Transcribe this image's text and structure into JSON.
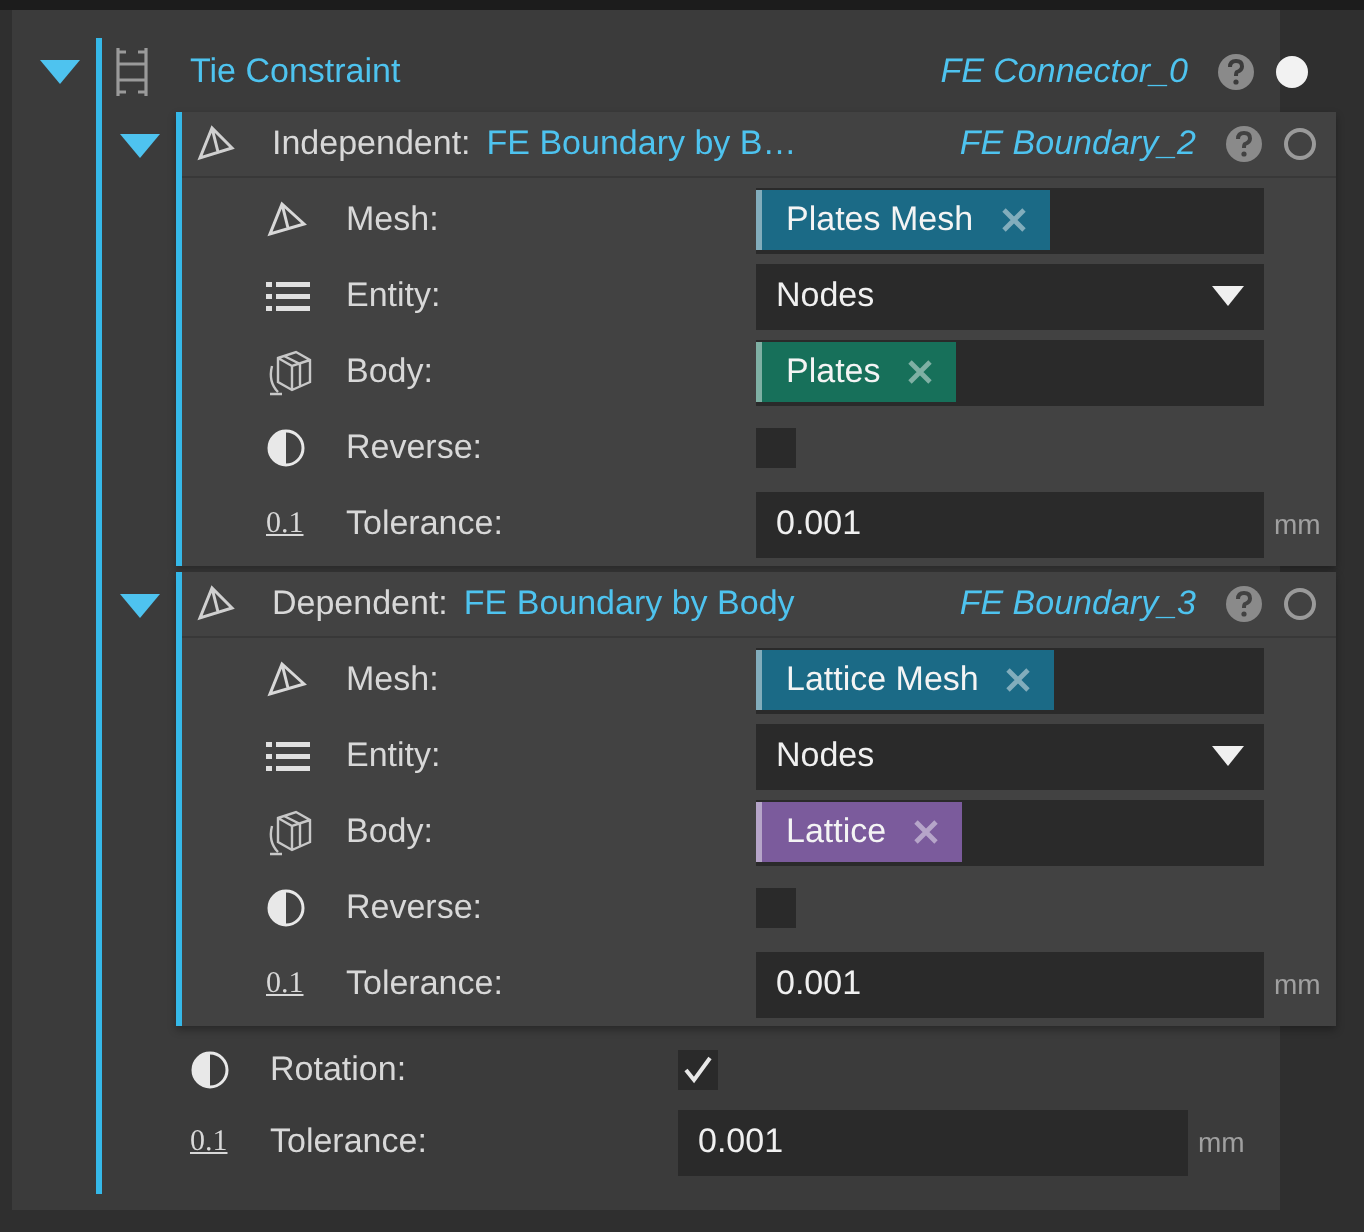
{
  "constraint": {
    "title": "Tie Constraint",
    "name": "FE Connector_0",
    "expanded": true,
    "active": true,
    "boundaries": [
      {
        "role": "Independent:",
        "type": "FE Boundary by B…",
        "name": "FE Boundary_2",
        "expanded": true,
        "active": false,
        "fields": [
          {
            "kind": "mesh",
            "label": "Mesh:",
            "tag": "Plates Mesh",
            "color": "#1b6a86"
          },
          {
            "kind": "entity",
            "label": "Entity:",
            "value": "Nodes"
          },
          {
            "kind": "body",
            "label": "Body:",
            "tag": "Plates",
            "color": "#17705a"
          },
          {
            "kind": "checkbox",
            "label": "Reverse:",
            "checked": false
          },
          {
            "kind": "number",
            "icon_text": "0.1",
            "label": "Tolerance:",
            "value": "0.001",
            "unit": "mm"
          }
        ]
      },
      {
        "role": "Dependent:",
        "type": "FE Boundary by Body",
        "name": "FE Boundary_3",
        "expanded": true,
        "active": false,
        "fields": [
          {
            "kind": "mesh",
            "label": "Mesh:",
            "tag": "Lattice Mesh",
            "color": "#1b6a86"
          },
          {
            "kind": "entity",
            "label": "Entity:",
            "value": "Nodes"
          },
          {
            "kind": "body",
            "label": "Body:",
            "tag": "Lattice",
            "color": "#7b5b9c"
          },
          {
            "kind": "checkbox",
            "label": "Reverse:",
            "checked": false
          },
          {
            "kind": "number",
            "icon_text": "0.1",
            "label": "Tolerance:",
            "value": "0.001",
            "unit": "mm"
          }
        ]
      }
    ],
    "fields": [
      {
        "kind": "checkbox",
        "label": "Rotation:",
        "checked": true
      },
      {
        "kind": "number",
        "icon_text": "0.1",
        "label": "Tolerance:",
        "value": "0.001",
        "unit": "mm"
      }
    ]
  }
}
